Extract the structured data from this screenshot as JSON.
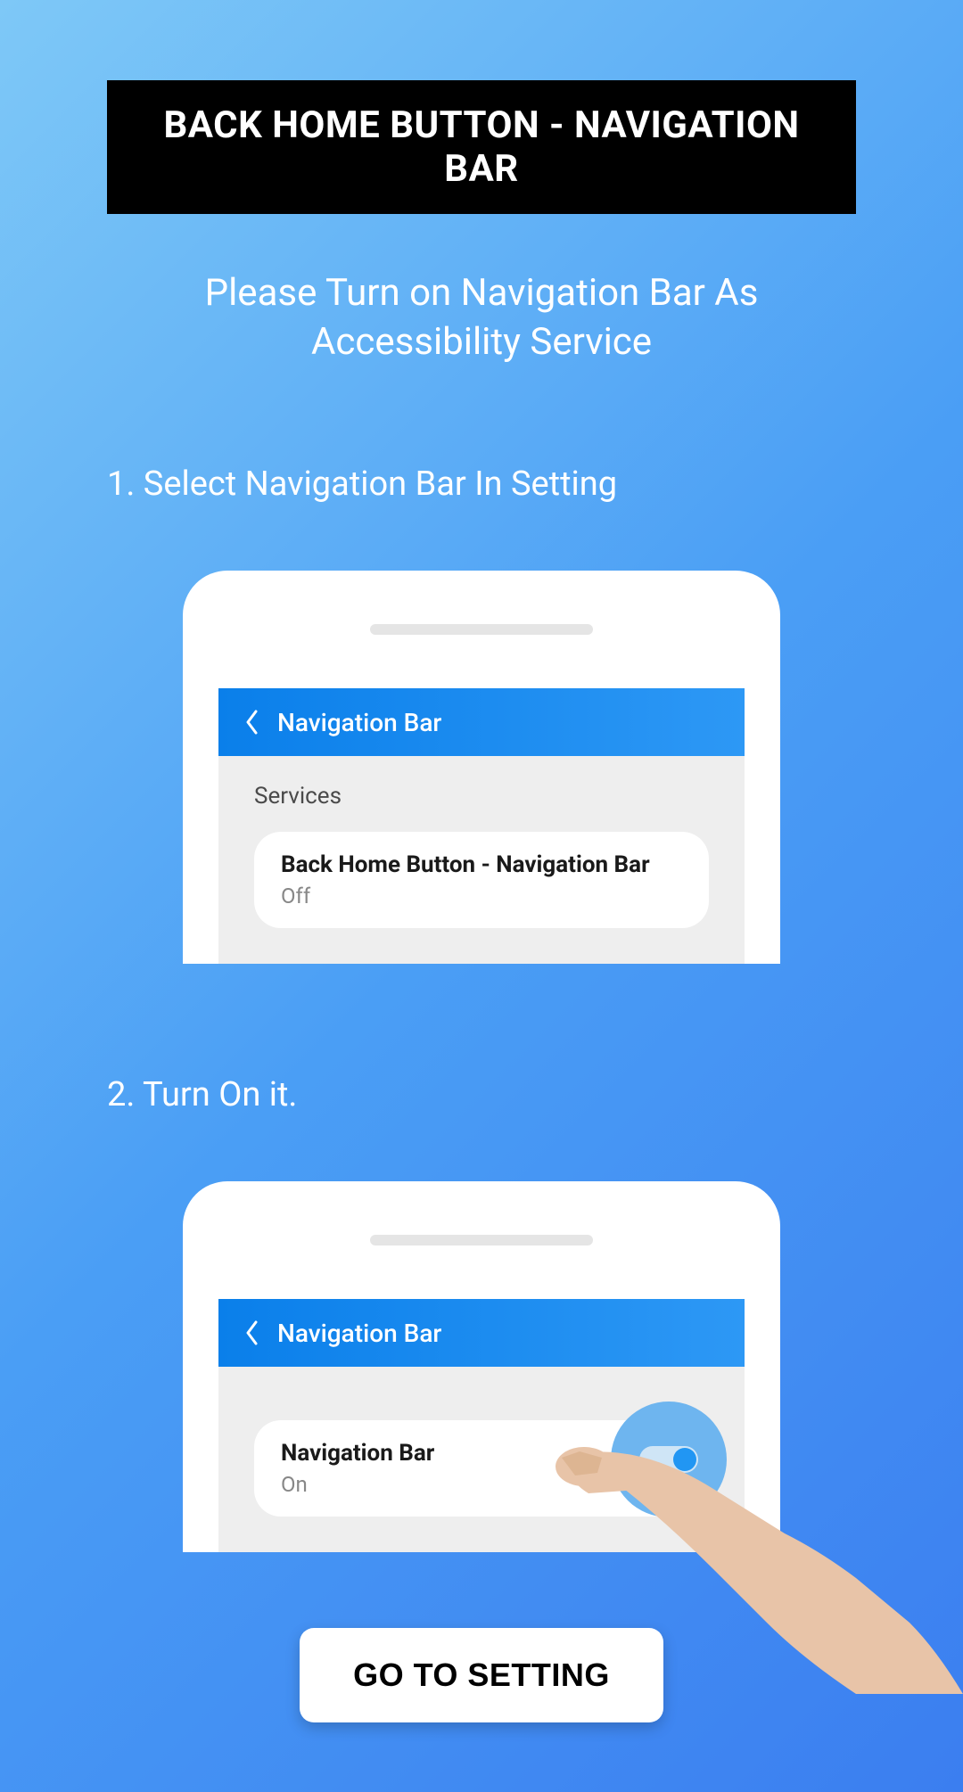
{
  "banner": {
    "title": "BACK HOME BUTTON - NAVIGATION BAR"
  },
  "instruction": "Please Turn on Navigation Bar As Accessibility Service",
  "steps": {
    "step1": {
      "label": "1. Select Navigation Bar In Setting",
      "header": "Navigation Bar",
      "section_label": "Services",
      "service_name": "Back Home Button - Navigation Bar",
      "service_status": "Off"
    },
    "step2": {
      "label": "2. Turn On it.",
      "header": "Navigation Bar",
      "service_name": "Navigation Bar",
      "service_status": "On"
    }
  },
  "button": {
    "go_setting": "GO TO SETTING"
  }
}
